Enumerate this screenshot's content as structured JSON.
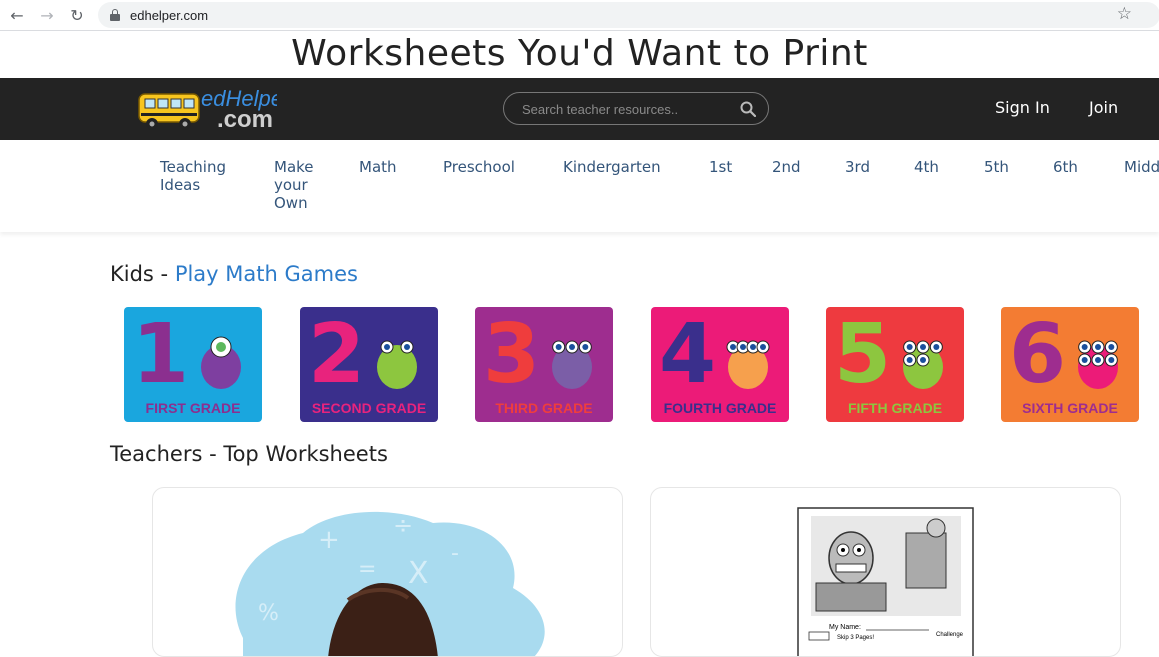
{
  "browser": {
    "url": "edhelper.com"
  },
  "tagline": "Worksheets You'd Want to Print",
  "header": {
    "logo_text_top": "edHelper",
    "logo_text_bottom": ".com",
    "search_placeholder": "Search teacher resources..",
    "sign_in": "Sign In",
    "join": "Join"
  },
  "menu": [
    "Teaching\nIdeas",
    "Make\nyour\nOwn",
    "Math",
    "Preschool",
    "Kindergarten",
    "1st",
    "2nd",
    "3rd",
    "4th",
    "5th",
    "6th",
    "Midd"
  ],
  "kids": {
    "title": "Kids - ",
    "link": "Play Math Games"
  },
  "grades": [
    {
      "num": "1",
      "label": "FIRST GRADE",
      "bg": "#1aa6de",
      "num_color": "#8b2f8f",
      "label_color": "#8b2f8f"
    },
    {
      "num": "2",
      "label": "SECOND GRADE",
      "bg": "#3a2f8c",
      "num_color": "#e8237d",
      "label_color": "#e8237d"
    },
    {
      "num": "3",
      "label": "THIRD GRADE",
      "bg": "#9e2d8f",
      "num_color": "#ef3d3d",
      "label_color": "#ef3d3d"
    },
    {
      "num": "4",
      "label": "FOURTH GRADE",
      "bg": "#ec1b78",
      "num_color": "#3a2f8c",
      "label_color": "#3a2f8c"
    },
    {
      "num": "5",
      "label": "FIFTH GRADE",
      "bg": "#ee3a3f",
      "num_color": "#8dc63f",
      "label_color": "#8dc63f"
    },
    {
      "num": "6",
      "label": "SIXTH GRADE",
      "bg": "#f37c33",
      "num_color": "#9e2d8f",
      "label_color": "#9e2d8f"
    }
  ],
  "teachers": {
    "title": "Teachers - Top Worksheets"
  },
  "worksheet_preview": {
    "name_label": "My Name:",
    "skip_label": "Skip 3 Pages!",
    "challenge_label": "Challenge"
  },
  "colors": {
    "header_bg": "#232323",
    "link_blue": "#2c7bc9",
    "menu_text": "#34557a"
  }
}
